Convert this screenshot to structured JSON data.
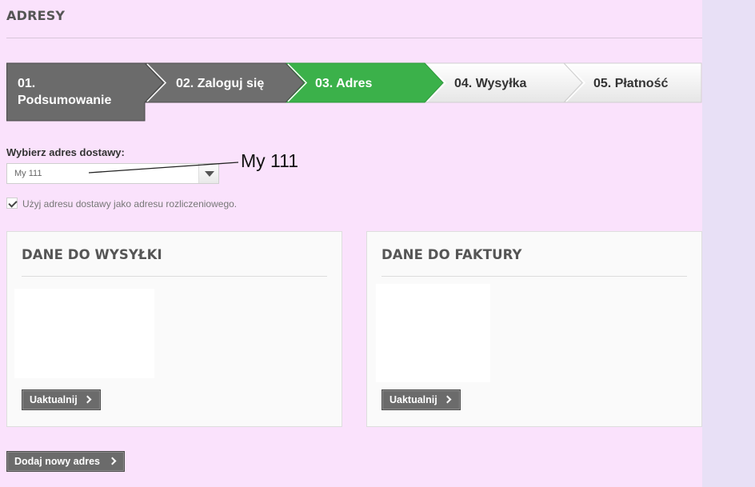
{
  "page": {
    "title": "ADRESY"
  },
  "steps": [
    {
      "line1": "01.",
      "line2": "Podsumowanie"
    },
    {
      "label": "02. Zaloguj się"
    },
    {
      "label": "03. Adres"
    },
    {
      "label": "04. Wysyłka"
    },
    {
      "label": "05. Płatność"
    }
  ],
  "delivery": {
    "label": "Wybierz adres dostawy:",
    "selected": "My 111",
    "annotation": "My 111"
  },
  "billing_same": {
    "checked": true,
    "label": "Użyj adresu dostawy jako adresu rozliczeniowego."
  },
  "shipping_panel": {
    "title": "DANE DO WYSYŁKI",
    "button": "Uaktualnij"
  },
  "invoice_panel": {
    "title": "DANE DO FAKTURY",
    "button": "Uaktualnij"
  },
  "add_address_button": "Dodaj nowy adres",
  "colors": {
    "page_bg": "#fae2fc",
    "step_done": "#6b6b6b",
    "step_active": "#3bb14a",
    "step_todo": "#f3f3f3"
  }
}
